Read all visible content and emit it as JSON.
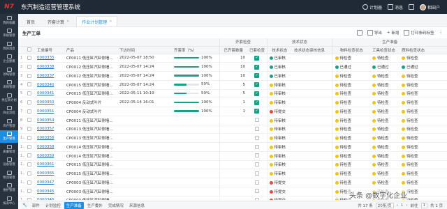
{
  "app": {
    "logo": "N7",
    "title": "东汽制造运营管理系统"
  },
  "topbar": {
    "scheduler": "计划器",
    "notify": "消息",
    "grid": "",
    "user": "相田户"
  },
  "sidebar": {
    "items": [
      {
        "label": "我的收藏"
      },
      {
        "label": "系统管理"
      },
      {
        "label": "我的消息"
      },
      {
        "label": "企业建模"
      },
      {
        "label": "领域管理"
      },
      {
        "label": "采购管理"
      },
      {
        "label": "供应商计划"
      },
      {
        "label": "商业流程"
      },
      {
        "label": "库存管理"
      },
      {
        "label": "生产管理"
      },
      {
        "label": "质量管理"
      },
      {
        "label": "设备管理"
      },
      {
        "label": "物流管理"
      },
      {
        "label": "维护管理"
      },
      {
        "label": "报表中心"
      }
    ],
    "active_index": 9
  },
  "tabs": [
    {
      "label": "首页",
      "closable": false
    },
    {
      "label": "齐套计算",
      "closable": true
    },
    {
      "label": "作业计划管理",
      "closable": true,
      "active": true
    }
  ],
  "page": {
    "title": "生产工单"
  },
  "tools": {
    "export": "导出",
    "add": "新增",
    "print": "打印条码标签",
    "grid_icon": "",
    "settings_icon": "",
    "refresh_icon": "",
    "more_icon": ""
  },
  "table": {
    "group_headers": {
      "kitting": "齐套检查",
      "tech": "技术状态",
      "prep": "生产准备"
    },
    "columns": [
      "工单编号",
      "产品",
      "下达时间",
      "齐套率（%）",
      "已齐套数量",
      "已套检查",
      "技术状态",
      "技术状态审核信息",
      "物料检查状态",
      "工具检查状态",
      "质料检查状态"
    ],
    "rows": [
      {
        "no": "1",
        "code": "0000335",
        "product": "CP0011 低压缸汽缸侧墙60...",
        "time": "2022-05-07 18:50",
        "pct": 100,
        "pct_label": "100%",
        "qty": "10",
        "checked": true,
        "tech": "已审核",
        "tech_color": "#16a085",
        "mat": "待检查",
        "mat_color": "#f1c40f",
        "tool": "待检查",
        "tool_color": "#f1c40f",
        "qc": "待检查",
        "qc_color": "#f1c40f"
      },
      {
        "no": "2",
        "code": "0000338",
        "product": "CP0012 低压缸汽缸侧墙60...",
        "time": "2022-05-07 14:24",
        "pct": 100,
        "pct_label": "100%",
        "qty": "10",
        "checked": true,
        "tech": "已审核",
        "tech_color": "#16a085",
        "mat": "已通过",
        "mat_color": "#16a085",
        "tool": "已通过",
        "tool_color": "#16a085",
        "qc": "已通过",
        "qc_color": "#16a085"
      },
      {
        "no": "3",
        "code": "0000337",
        "product": "CP0012 低压缸汽缸侧墙60...",
        "time": "2022-05-07 14:24",
        "pct": 100,
        "pct_label": "100%",
        "qty": "10",
        "checked": true,
        "tech": "已审核",
        "tech_color": "#16a085",
        "mat": "待检查",
        "mat_color": "#f1c40f",
        "tool": "待检查",
        "tool_color": "#f1c40f",
        "qc": "待检查",
        "qc_color": "#f1c40f"
      },
      {
        "no": "4",
        "code": "0000340",
        "product": "CP0015 低压缸汽缸侧墙6...",
        "time": "2022-05-07 14:24",
        "pct": 50,
        "pct_label": "50%",
        "qty": "5",
        "checked": true,
        "tech": "待审核",
        "tech_color": "#f1c40f",
        "mat": "待检查",
        "mat_color": "#f1c40f",
        "tool": "待检查",
        "tool_color": "#f1c40f",
        "qc": "待检查",
        "qc_color": "#f1c40f"
      },
      {
        "no": "5",
        "code": "0000341",
        "product": "CP0015 低压缸汽缸侧墙6...",
        "time": "2022-05-11 10:19",
        "pct": 50,
        "pct_label": "50%",
        "qty": "5",
        "checked": true,
        "tech": "待审核",
        "tech_color": "#f1c40f",
        "mat": "待检查",
        "mat_color": "#f1c40f",
        "tool": "待检查",
        "tool_color": "#f1c40f",
        "qc": "待检查",
        "qc_color": "#f1c40f"
      },
      {
        "no": "6",
        "code": "0000350",
        "product": "CP0004 反动式叶片",
        "time": "2022-05-14 16:01",
        "pct": 100,
        "pct_label": "100%",
        "qty": "1",
        "checked": true,
        "tech": "待审核",
        "tech_color": "#f1c40f",
        "mat": "待检查",
        "mat_color": "#f1c40f",
        "tool": "待检查",
        "tool_color": "#f1c40f",
        "qc": "待检查",
        "qc_color": "#f1c40f"
      },
      {
        "no": "7",
        "code": "0000351",
        "product": "CP0004 反动式叶片",
        "time": "",
        "pct": 100,
        "pct_label": "100%",
        "qty": "1",
        "checked": true,
        "tech": "待提交",
        "tech_color": "#e74c3c",
        "mat": "待检查",
        "mat_color": "#f1c40f",
        "tool": "待检查",
        "tool_color": "#f1c40f",
        "qc": "待检查",
        "qc_color": "#f1c40f"
      },
      {
        "no": "8",
        "code": "0000354",
        "product": "CP0011 低压缸汽缸侧墙6...",
        "time": "",
        "pct": null,
        "pct_label": "",
        "qty": "",
        "checked": false,
        "tech": "待审核",
        "tech_color": "#f1c40f",
        "mat": "待检查",
        "mat_color": "#f1c40f",
        "tool": "待检查",
        "tool_color": "#f1c40f",
        "qc": "待检查",
        "qc_color": "#f1c40f"
      },
      {
        "no": "9",
        "code": "0000357",
        "product": "CP0013 低压缸汽缸侧墙6...",
        "time": "",
        "pct": null,
        "pct_label": "",
        "qty": "",
        "checked": false,
        "tech": "待审核",
        "tech_color": "#f1c40f",
        "mat": "待检查",
        "mat_color": "#f1c40f",
        "tool": "待检查",
        "tool_color": "#f1c40f",
        "qc": "待检查",
        "qc_color": "#f1c40f"
      },
      {
        "no": "10",
        "code": "0000356",
        "product": "CP0013 低压缸汽缸侧墙6...",
        "time": "",
        "pct": null,
        "pct_label": "",
        "qty": "",
        "checked": false,
        "tech": "待审核",
        "tech_color": "#f1c40f",
        "mat": "待检查",
        "mat_color": "#f1c40f",
        "tool": "待检查",
        "tool_color": "#f1c40f",
        "qc": "待检查",
        "qc_color": "#f1c40f"
      },
      {
        "no": "11",
        "code": "0000358",
        "product": "CP0014 低压缸汽缸侧墙6...",
        "time": "",
        "pct": null,
        "pct_label": "",
        "qty": "",
        "checked": false,
        "tech": "待审核",
        "tech_color": "#f1c40f",
        "mat": "待检查",
        "mat_color": "#f1c40f",
        "tool": "待检查",
        "tool_color": "#f1c40f",
        "qc": "待检查",
        "qc_color": "#f1c40f"
      },
      {
        "no": "12",
        "code": "0000359",
        "product": "CP0014 低压缸汽缸侧墙6...",
        "time": "",
        "pct": null,
        "pct_label": "",
        "qty": "",
        "checked": false,
        "tech": "待审核",
        "tech_color": "#f1c40f",
        "mat": "待检查",
        "mat_color": "#f1c40f",
        "tool": "待检查",
        "tool_color": "#f1c40f",
        "qc": "待检查",
        "qc_color": "#f1c40f"
      },
      {
        "no": "13",
        "code": "0000361",
        "product": "CP0015 低压缸汽缸侧墙6...",
        "time": "",
        "pct": null,
        "pct_label": "",
        "qty": "",
        "checked": false,
        "tech": "待审核",
        "tech_color": "#f1c40f",
        "mat": "待检查",
        "mat_color": "#f1c40f",
        "tool": "待检查",
        "tool_color": "#f1c40f",
        "qc": "待检查",
        "qc_color": "#f1c40f"
      },
      {
        "no": "14",
        "code": "0000365",
        "product": "CP0015 低压缸汽缸侧墙6...",
        "time": "",
        "pct": null,
        "pct_label": "",
        "qty": "",
        "checked": false,
        "tech": "待审核",
        "tech_color": "#f1c40f",
        "mat": "待检查",
        "mat_color": "#f1c40f",
        "tool": "待检查",
        "tool_color": "#f1c40f",
        "qc": "待检查",
        "qc_color": "#f1c40f"
      },
      {
        "no": "15",
        "code": "0000347",
        "product": "CP0003 低压缸汽缸侧墙6...",
        "time": "",
        "pct": null,
        "pct_label": "",
        "qty": "",
        "checked": false,
        "tech": "待提交",
        "tech_color": "#e74c3c",
        "mat": "待检查",
        "mat_color": "#f1c40f",
        "tool": "待检查",
        "tool_color": "#f1c40f",
        "qc": "待检查",
        "qc_color": "#f1c40f"
      },
      {
        "no": "16",
        "code": "0000345",
        "product": "CP0003 低压缸汽缸侧墙6...",
        "time": "",
        "pct": null,
        "pct_label": "",
        "qty": "",
        "checked": false,
        "tech": "待提交",
        "tech_color": "#e74c3c",
        "mat": "待检查",
        "mat_color": "#f1c40f",
        "tool": "待检查",
        "tool_color": "#f1c40f",
        "qc": "待检查",
        "qc_color": "#f1c40f"
      },
      {
        "no": "17",
        "code": "0000346",
        "product": "CP0003 低压缸汽缸侧墙6...",
        "time": "",
        "pct": null,
        "pct_label": "",
        "qty": "",
        "checked": false,
        "tech": "待提交",
        "tech_color": "#e74c3c",
        "mat": "待检查",
        "mat_color": "#f1c40f",
        "tool": "待检查",
        "tool_color": "#f1c40f",
        "qc": "待检查",
        "qc_color": "#f1c40f"
      }
    ]
  },
  "bottom": {
    "tabs": [
      "部件",
      "计划监控",
      "生产准备",
      "生产委外",
      "完成情况",
      "来源信息"
    ],
    "active_tab": 2,
    "pager": {
      "total": "共 17 条",
      "page_size": "20条/页",
      "prev": "‹",
      "page": "1",
      "next": "›",
      "goto": "前往",
      "goto_page": "1",
      "page_total": "共 1 页"
    }
  },
  "watermark": "头条 @数字化企业"
}
